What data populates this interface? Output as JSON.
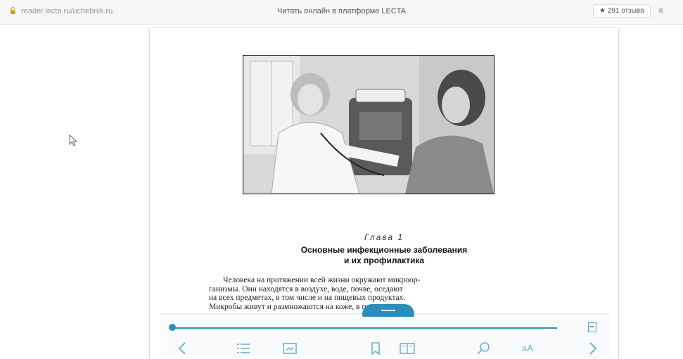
{
  "topbar": {
    "url": "reader.lecta.ru/uchebnik.ru",
    "title": "Читать онлайн в платформе LECTA",
    "rating": "★ 291 отзыва",
    "menu_icon": "≡"
  },
  "page": {
    "chapter": "Глава 1",
    "heading_line1": "Основные инфекционные заболевания",
    "heading_line2": "и их профилактика",
    "body_lines": [
      "Человека на протяжении всей жизни окружают микроор-",
      "ганизмы. Они находятся в воздухе, воде, почве, оседают",
      "на всех предметах, в том числе и на пищевых продуктах.",
      "Микробы живут и размножаются на коже, в полости рта и"
    ]
  },
  "toolbar": {
    "progress": 0.0,
    "icons": [
      "chevron-left-icon",
      "list-icon",
      "gallery-icon",
      "bookmark-icon",
      "book-icon",
      "search-icon",
      "font-size-icon",
      "chevron-right-icon"
    ],
    "font_label": "аА"
  }
}
